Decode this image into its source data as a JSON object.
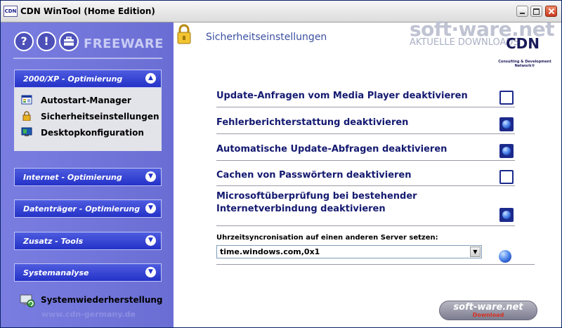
{
  "window": {
    "app_icon_text": "CDN",
    "title": "CDN WinTool (Home Edition)"
  },
  "sidebar": {
    "freeware_label": "FREEWARE",
    "header_icons": [
      "help-icon",
      "info-icon",
      "toolbox-icon"
    ],
    "help_glyph": "?",
    "info_glyph": "!",
    "sections": [
      {
        "label": "2000/XP - Optimierung",
        "expanded": true
      },
      {
        "label": "Internet - Optimierung",
        "expanded": false
      },
      {
        "label": "Datenträger - Optimierung",
        "expanded": false
      },
      {
        "label": "Zusatz - Tools",
        "expanded": false
      },
      {
        "label": "Systemanalyse",
        "expanded": false
      }
    ],
    "items": [
      {
        "label": "Autostart-Manager",
        "icon": "autostart-icon"
      },
      {
        "label": "Sicherheitseinstellungen",
        "icon": "lock-icon"
      },
      {
        "label": "Desktopkonfiguration",
        "icon": "desktop-icon"
      }
    ],
    "restore_label": "Systemwiederherstellung",
    "website": "www.cdn-germany.de"
  },
  "content": {
    "title": "Sicherheitseinstellungen",
    "brand": {
      "main": "soft·ware.net",
      "sub": "AKTUELLE DOWNLOADS",
      "cdn": "CDN",
      "cdn_sub": "Consulting & Development Network®"
    },
    "options": [
      {
        "label": "Update-Anfragen vom Media Player deaktivieren",
        "checked": false
      },
      {
        "label": "Fehlerberichterstattung deaktivieren",
        "checked": true
      },
      {
        "label": "Automatische Update-Abfragen deaktivieren",
        "checked": true
      },
      {
        "label": "Cachen von Passwörtern deaktivieren",
        "checked": false
      },
      {
        "label_line1": "Microsoftüberprüfung bei bestehender",
        "label_line2": "Internetverbindung deaktivieren",
        "checked": true
      }
    ],
    "sync": {
      "label": "Uhrzeitsyncronisation auf einen anderen Server setzen:",
      "value": "time.windows.com,0x1"
    },
    "badge": {
      "line1": "soft-ware.net",
      "line2": "Download"
    }
  },
  "colors": {
    "sidebar_bg": "#6a6ed4",
    "section_blue": "#2432c8",
    "label_navy": "#141a70",
    "title_blue": "#3b4fa0"
  }
}
